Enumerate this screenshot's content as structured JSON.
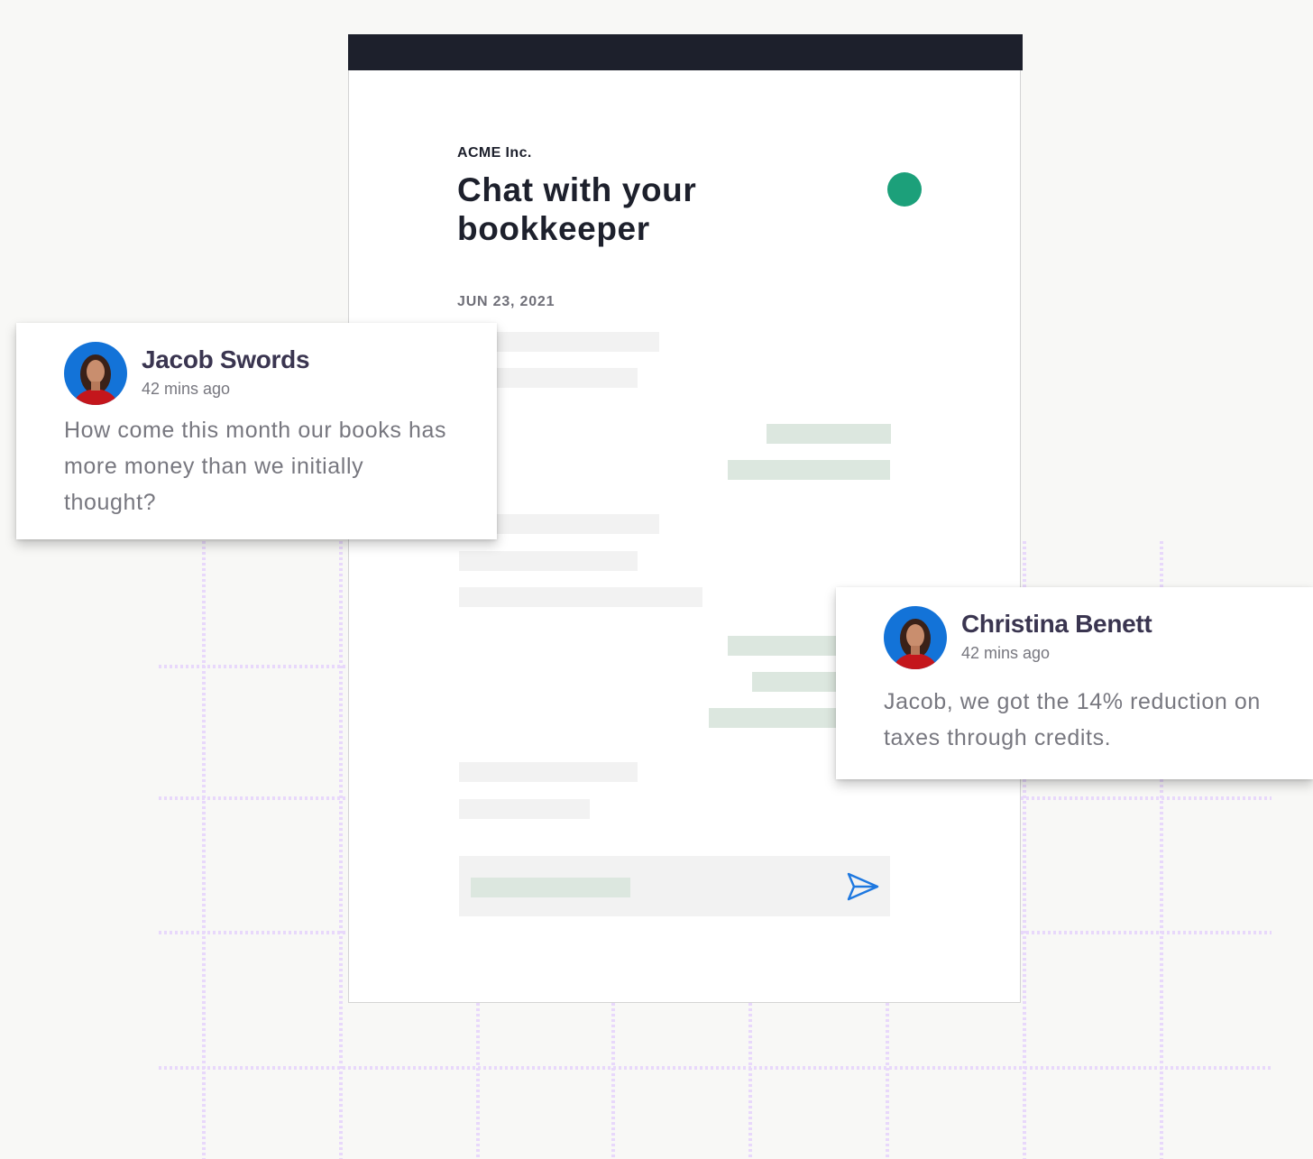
{
  "card": {
    "company": "ACME Inc.",
    "title": "Chat with your bookkeeper",
    "date": "JUN 23, 2021"
  },
  "comments": [
    {
      "name": "Jacob Swords",
      "time": "42 mins ago",
      "message": "How come this month our books has more money than we initially thought?"
    },
    {
      "name": "Christina Benett",
      "time": "42 mins ago",
      "message": "Jacob, we got the 14% reduction on taxes through credits."
    }
  ],
  "icons": {
    "send": "send-icon",
    "avatar": "avatar"
  },
  "colors": {
    "topbar": "#1d202c",
    "status_online": "#1ca07a",
    "incoming_placeholder": "#f2f2f2",
    "outgoing_placeholder": "#dce7df",
    "send_icon": "#1e78e0",
    "avatar_bg": "#1373d8",
    "grid": "#e8d8fb"
  }
}
